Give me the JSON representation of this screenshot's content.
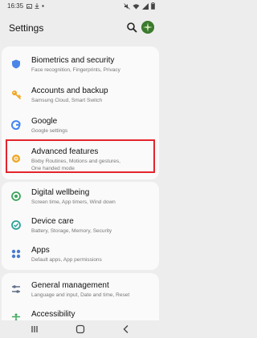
{
  "status_bar": {
    "time": "16:35"
  },
  "header": {
    "title": "Settings"
  },
  "settings_items": [
    {
      "title": "Biometrics and security",
      "subtitle": "Face recognition, Fingerprints, Privacy",
      "icon": "shield-icon",
      "color": "#4a86e8"
    },
    {
      "title": "Accounts and backup",
      "subtitle": "Samsung Cloud, Smart Switch",
      "icon": "key-icon",
      "color": "#f0a623"
    },
    {
      "title": "Google",
      "subtitle": "Google settings",
      "icon": "google-icon",
      "color": "#4285f4"
    },
    {
      "title": "Advanced features",
      "subtitle": "Bixby Routines, Motions and gestures, One handed mode",
      "icon": "gear-plus-icon",
      "color": "#f0a623"
    },
    {
      "title": "Digital wellbeing",
      "subtitle": "Screen time, App timers, Wind down",
      "icon": "wellbeing-icon",
      "color": "#3ba55c"
    },
    {
      "title": "Device care",
      "subtitle": "Battery, Storage, Memory, Security",
      "icon": "device-care-icon",
      "color": "#2ba199"
    },
    {
      "title": "Apps",
      "subtitle": "Default apps, App permissions",
      "icon": "apps-icon",
      "color": "#4a7bd0"
    },
    {
      "title": "General management",
      "subtitle": "Language and input, Date and time, Reset",
      "icon": "sliders-icon",
      "color": "#5f6f87"
    },
    {
      "title": "Accessibility",
      "subtitle": "",
      "icon": "accessibility-icon",
      "color": "#3ba55c"
    }
  ],
  "colors": {
    "highlight": "#e4242c",
    "background": "#ededed",
    "card": "#fafafa"
  }
}
